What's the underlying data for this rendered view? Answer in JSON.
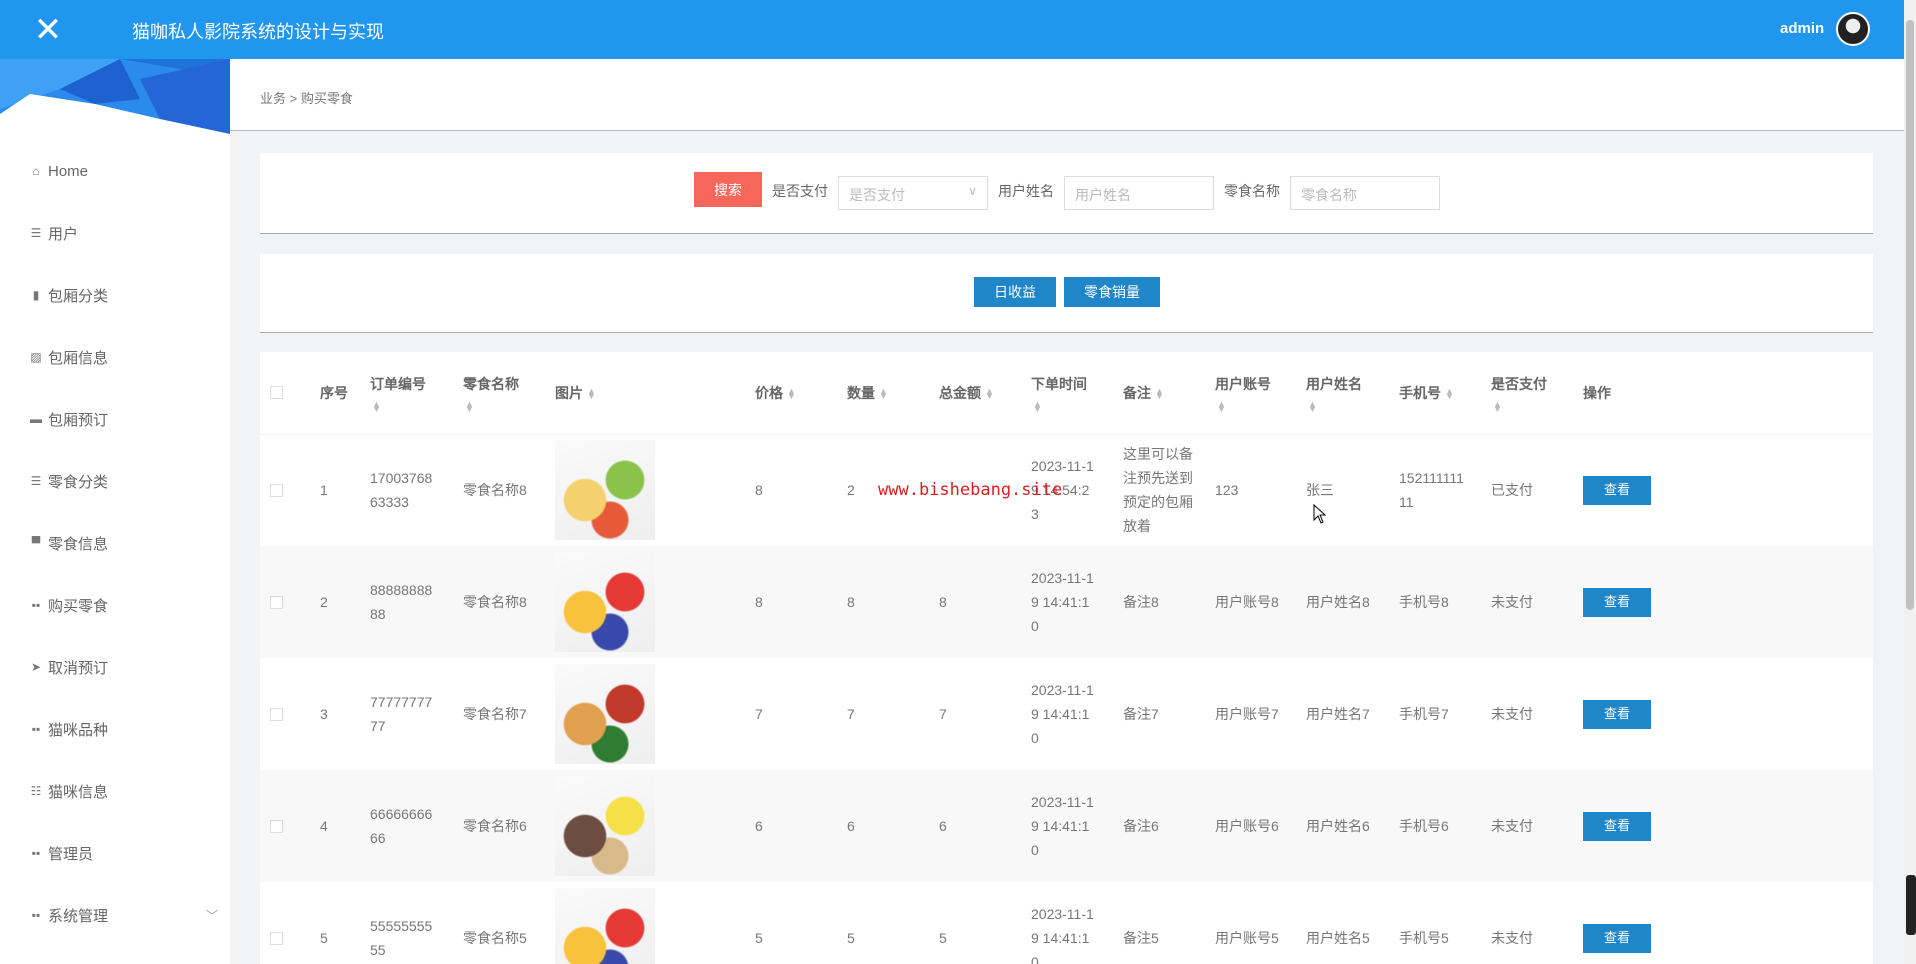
{
  "header": {
    "title": "猫咖私人影院系统的设计与实现",
    "user": "admin",
    "close_icon": "close-icon",
    "brand_color": "#2196ee"
  },
  "sidebar": {
    "items": [
      {
        "label": "Home",
        "icon": "home-icon"
      },
      {
        "label": "用户",
        "icon": "list-icon"
      },
      {
        "label": "包厢分类",
        "icon": "bar-chart-icon"
      },
      {
        "label": "包厢信息",
        "icon": "line-chart-icon"
      },
      {
        "label": "包厢预订",
        "icon": "comment-icon"
      },
      {
        "label": "零食分类",
        "icon": "list-icon"
      },
      {
        "label": "零食信息",
        "icon": "monitor-icon"
      },
      {
        "label": "购买零食",
        "icon": "grid-icon"
      },
      {
        "label": "取消预订",
        "icon": "send-icon"
      },
      {
        "label": "猫咪品种",
        "icon": "grid-icon"
      },
      {
        "label": "猫咪信息",
        "icon": "sliders-icon"
      },
      {
        "label": "管理员",
        "icon": "grid-icon"
      },
      {
        "label": "系统管理",
        "icon": "grid-icon",
        "expandable": true
      }
    ]
  },
  "breadcrumb": {
    "parent": "业务",
    "separator": ">",
    "current": "购买零食"
  },
  "search": {
    "button": "搜索",
    "paid_label": "是否支付",
    "paid_placeholder": "是否支付",
    "username_label": "用户姓名",
    "username_placeholder": "用户姓名",
    "snack_label": "零食名称",
    "snack_placeholder": "零食名称",
    "button_color": "#f7665a"
  },
  "actions": {
    "daily_income": "日收益",
    "snack_sales": "零食销量",
    "button_color": "#1e86c9"
  },
  "table": {
    "headers": [
      "序号",
      "订单编号",
      "零食名称",
      "图片",
      "价格",
      "数量",
      "总金额",
      "下单时间",
      "备注",
      "用户账号",
      "用户姓名",
      "手机号",
      "是否支付",
      "操作"
    ],
    "view_label": "查看",
    "rows": [
      {
        "idx": "1",
        "order": "1700376863333",
        "name": "零食名称8",
        "price": "8",
        "qty": "2",
        "total": "",
        "time": "2023-11-19 14:54:23",
        "remark": "这里可以备注预先送到预定的包厢放着",
        "account": "123",
        "username": "张三",
        "phone": "15211111111",
        "paid": "已支付"
      },
      {
        "idx": "2",
        "order": "8888888888",
        "name": "零食名称8",
        "price": "8",
        "qty": "8",
        "total": "8",
        "time": "2023-11-19 14:41:10",
        "remark": "备注8",
        "account": "用户账号8",
        "username": "用户姓名8",
        "phone": "手机号8",
        "paid": "未支付"
      },
      {
        "idx": "3",
        "order": "7777777777",
        "name": "零食名称7",
        "price": "7",
        "qty": "7",
        "total": "7",
        "time": "2023-11-19 14:41:10",
        "remark": "备注7",
        "account": "用户账号7",
        "username": "用户姓名7",
        "phone": "手机号7",
        "paid": "未支付"
      },
      {
        "idx": "4",
        "order": "6666666666",
        "name": "零食名称6",
        "price": "6",
        "qty": "6",
        "total": "6",
        "time": "2023-11-19 14:41:10",
        "remark": "备注6",
        "account": "用户账号6",
        "username": "用户姓名6",
        "phone": "手机号6",
        "paid": "未支付"
      },
      {
        "idx": "5",
        "order": "5555555555",
        "name": "零食名称5",
        "price": "5",
        "qty": "5",
        "total": "5",
        "time": "2023-11-19 14:41:10",
        "remark": "备注5",
        "account": "用户账号5",
        "username": "用户姓名5",
        "phone": "手机号5",
        "paid": "未支付"
      }
    ]
  },
  "watermark": "www.bishebang.site"
}
